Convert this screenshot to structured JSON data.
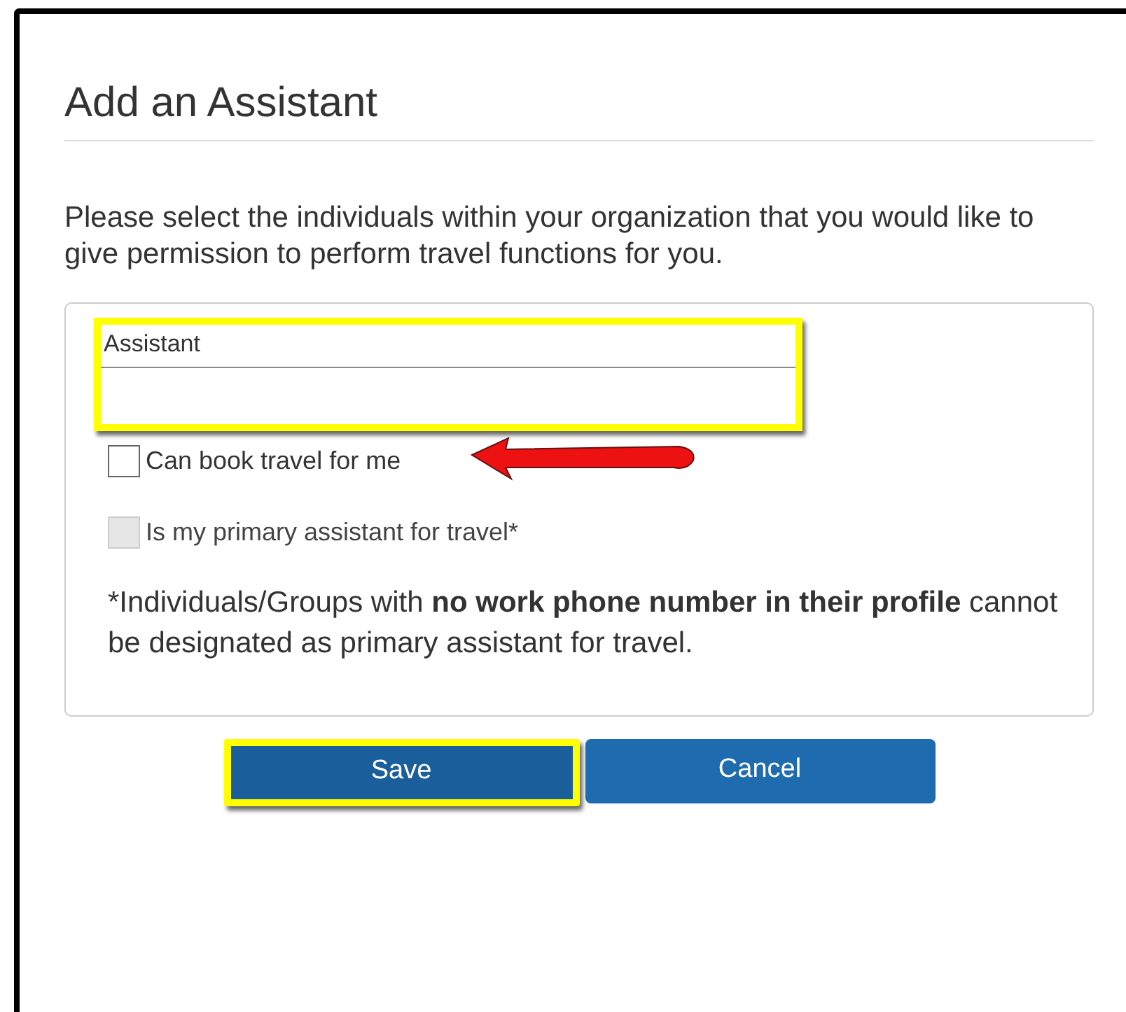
{
  "dialog": {
    "title": "Add an Assistant",
    "intro": "Please select the individuals within your organization that you would like to give permission to perform travel functions for you.",
    "field": {
      "label": "Assistant",
      "highlighted": true
    },
    "options": [
      {
        "label": "Can book travel for me",
        "checked": false,
        "disabled": false,
        "arrow": true
      },
      {
        "label": "Is my primary assistant for travel*",
        "checked": false,
        "disabled": true,
        "arrow": false
      }
    ],
    "note": "*Individuals/Groups with **no work phone number in their profile** cannot be designated as primary assistant for travel.",
    "buttons": [
      {
        "label": "Save",
        "highlighted": true
      },
      {
        "label": "Cancel",
        "highlighted": false
      }
    ]
  }
}
